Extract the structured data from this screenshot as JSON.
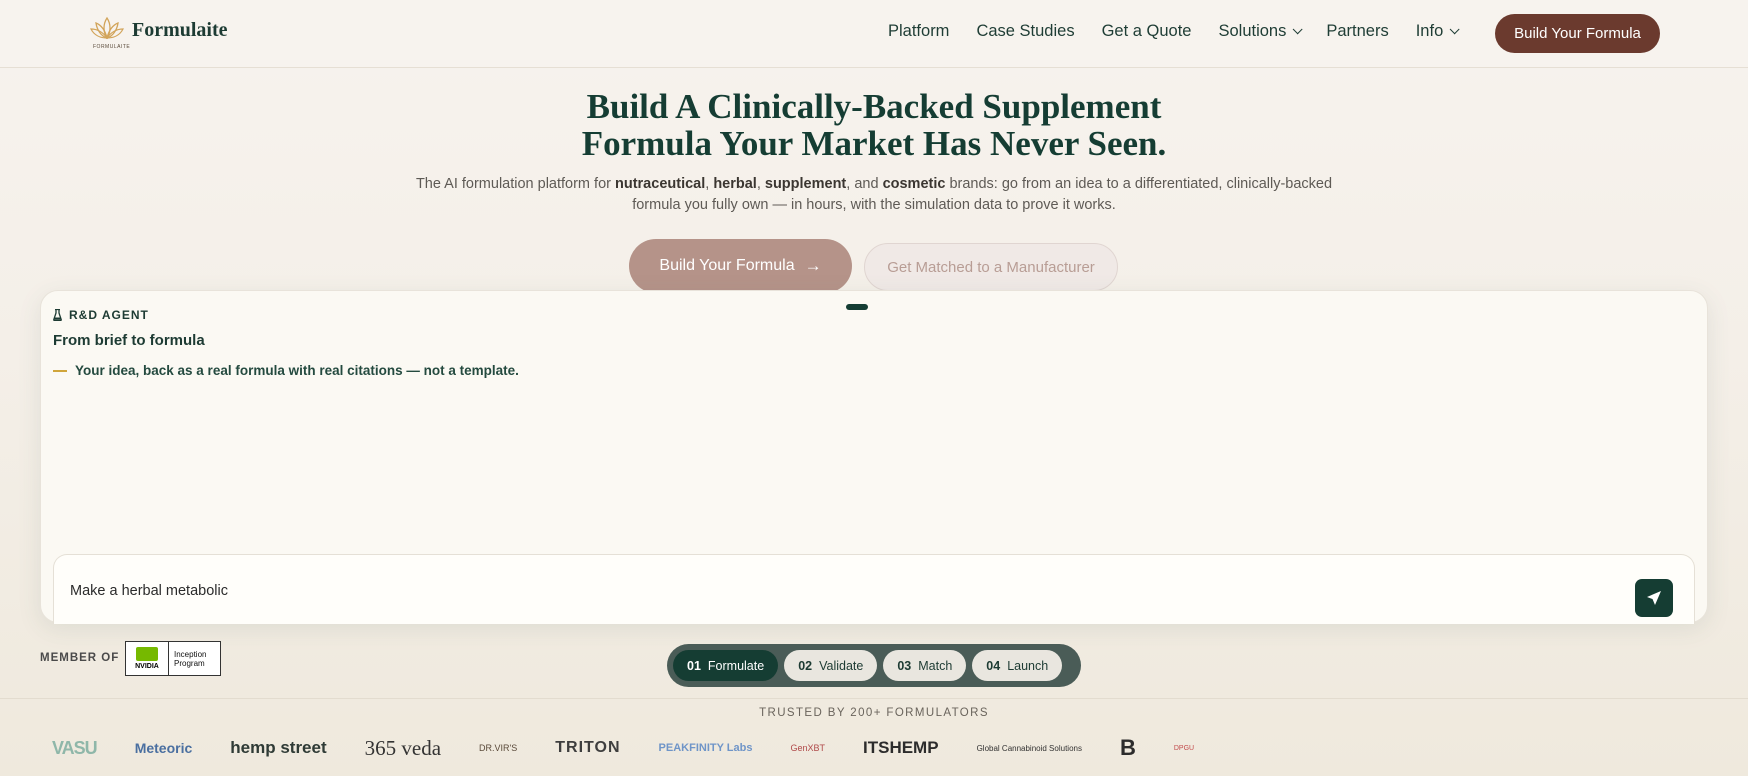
{
  "nav": {
    "brand": "Formulaite",
    "brand_sub": "FORMULAITE",
    "links": [
      {
        "label": "Platform",
        "dropdown": false
      },
      {
        "label": "Case Studies",
        "dropdown": false
      },
      {
        "label": "Get a Quote",
        "dropdown": false
      },
      {
        "label": "Solutions",
        "dropdown": true
      },
      {
        "label": "Partners",
        "dropdown": false
      },
      {
        "label": "Info",
        "dropdown": true
      }
    ],
    "cta": "Build Your Formula"
  },
  "hero": {
    "title_line1": "Build A Clinically-Backed Supplement",
    "title_line2": "Formula Your Market Has Never Seen.",
    "sub_intro": "The AI formulation platform for",
    "sub_kw1": "nutraceutical",
    "sub_kw2": "herbal",
    "sub_kw3": "supplement",
    "sub_and": "and",
    "sub_kw4": "cosmetic",
    "sub_rest": "brands: go from an idea to a differentiated, clinically-backed formula you fully own — in hours, with the simulation data to prove it works.",
    "primary_button": "Build Your Formula",
    "secondary_button": "Get Matched to a Manufacturer"
  },
  "agent": {
    "badge": "R&D AGENT",
    "title": "From brief to formula",
    "message": "Your idea, back as a real formula with real citations — not a template.",
    "input_value": "Make a herbal metabolic"
  },
  "member": {
    "label": "MEMBER OF",
    "nvidia_word": "NVIDIA",
    "program_line1": "Inception",
    "program_line2": "Program"
  },
  "steps": [
    {
      "num": "01",
      "label": "Formulate",
      "active": true
    },
    {
      "num": "02",
      "label": "Validate",
      "active": false
    },
    {
      "num": "03",
      "label": "Match",
      "active": false
    },
    {
      "num": "04",
      "label": "Launch",
      "active": false
    }
  ],
  "trusted": {
    "heading": "TRUSTED BY 200+ FORMULATORS",
    "logos": [
      "VASU",
      "Meteoric",
      "hemp street",
      "365 veda",
      "DR.VIR'S",
      "TRITON",
      "PEAKFINITY Labs",
      "GenXBT",
      "ITSHEMP",
      "Global Cannabinoid Solutions",
      "B",
      "DPGU"
    ]
  },
  "colors": {
    "brand_dark": "#153d33",
    "cta_brown": "#6b3a2e",
    "accent_gold": "#d0a53a"
  }
}
